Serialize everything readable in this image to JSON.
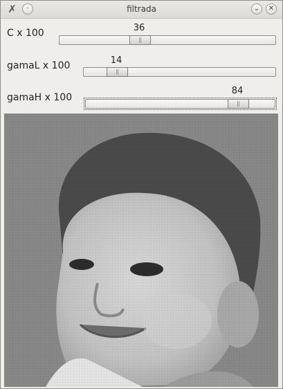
{
  "window": {
    "title": "filtrada"
  },
  "sliders": [
    {
      "label": "C x 100",
      "value": "36"
    },
    {
      "label": "gamaL x 100",
      "value": "14"
    },
    {
      "label": "gamaH x 100",
      "value": "84"
    }
  ],
  "image": {
    "description_icon": "filtered-baby-photo"
  }
}
